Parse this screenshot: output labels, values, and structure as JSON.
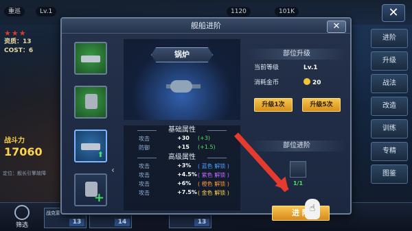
{
  "hud": {
    "ship_name": "重巡",
    "level": "Lv.1",
    "resource_1": "1120",
    "resource_2": "101K",
    "close": "✕"
  },
  "left_panel": {
    "stars": "★★★",
    "aptitude": "资质：13",
    "cost": "COST：6",
    "power_label": "战斗力",
    "power_value": "17060",
    "location": "定位：舰长引擎故障"
  },
  "right_menu": [
    "进阶",
    "升级",
    "战法",
    "改造",
    "训练",
    "专精",
    "图鉴"
  ],
  "bottom": {
    "filter_label": "筛选",
    "ships": [
      {
        "name": "战克蒙哥",
        "level": "13"
      },
      {
        "name": "纳尔逊",
        "level": "14"
      },
      {
        "name": "标柏",
        "level": "13"
      }
    ]
  },
  "modal": {
    "title": "舰船进阶",
    "close": "✕",
    "parts_icons": [
      "battleship-icon",
      "turret-icon",
      "boiler-icon",
      "crane-icon"
    ],
    "part_title": "锅炉",
    "basic_title": "基础属性",
    "basic": [
      {
        "key": "攻击",
        "value": "+30",
        "delta": "(+3)"
      },
      {
        "key": "防御",
        "value": "+15",
        "delta": "(+1.5)"
      }
    ],
    "advanced_title": "高级属性",
    "advanced": [
      {
        "key": "攻击",
        "value": "+3%",
        "lock": "( 蓝色 解锁 )",
        "color": "blue"
      },
      {
        "key": "攻击",
        "value": "+4.5%",
        "lock": "( 紫色 解锁 )",
        "color": "purple"
      },
      {
        "key": "攻击",
        "value": "+6%",
        "lock": "( 橙色 解锁 )",
        "color": "orange"
      },
      {
        "key": "攻击",
        "value": "+7.5%",
        "lock": "( 金色 解锁 )",
        "color": "gold"
      }
    ],
    "upgrade": {
      "title": "部位升级",
      "level_label": "当前等级",
      "level_value": "Lv.1",
      "cost_label": "消耗金币",
      "cost_value": "20",
      "btn_1": "升级1次",
      "btn_5": "升级5次"
    },
    "advance": {
      "title": "部位进阶",
      "count": "1/1",
      "button": "进 阶"
    }
  }
}
